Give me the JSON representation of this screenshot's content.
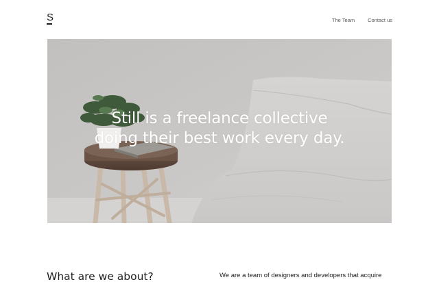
{
  "header": {
    "logo": "S",
    "nav": [
      {
        "label": "The Team"
      },
      {
        "label": "Contact us"
      }
    ]
  },
  "hero": {
    "line1": "Still is a freelance collective",
    "line2": "doing their best work every day."
  },
  "about": {
    "heading": "What are we about?",
    "text": "We are a team of designers and developers that acquire"
  },
  "colors": {
    "hero_background": "#c9c7c5",
    "text": "#222222",
    "nav_text": "#555555"
  }
}
